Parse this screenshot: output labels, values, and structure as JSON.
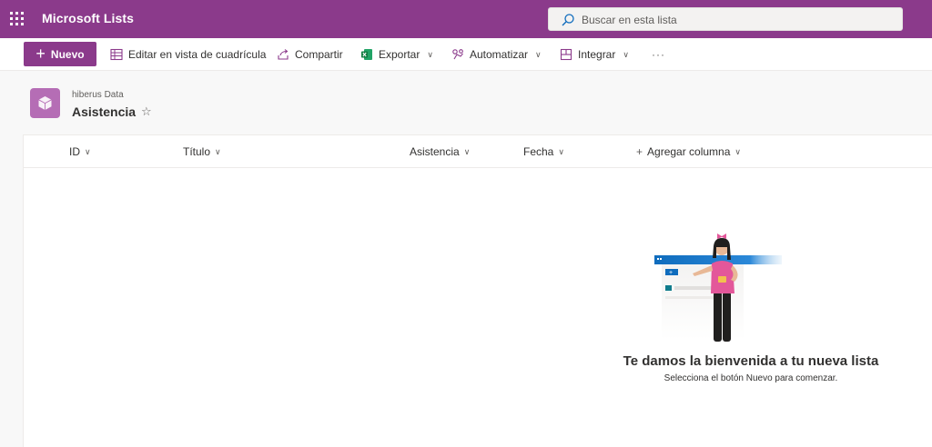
{
  "suite": {
    "app_title": "Microsoft Lists",
    "search_placeholder": "Buscar en esta lista"
  },
  "command_bar": {
    "new_label": "Nuevo",
    "grid_edit_label": "Editar en vista de cuadrícula",
    "share_label": "Compartir",
    "export_label": "Exportar",
    "automate_label": "Automatizar",
    "integrate_label": "Integrar",
    "more_label": "···"
  },
  "page_header": {
    "site_name": "hiberus Data",
    "list_title": "Asistencia",
    "star": "☆"
  },
  "columns": [
    {
      "label": "ID"
    },
    {
      "label": "Título"
    },
    {
      "label": "Asistencia"
    },
    {
      "label": "Fecha"
    },
    {
      "label": "Agregar columna"
    }
  ],
  "empty_state": {
    "title": "Te damos la bienvenida a tu nueva lista",
    "subtitle": "Selecciona el botón Nuevo para comenzar."
  },
  "colors": {
    "brand": "#8b3a8b",
    "site_icon": "#b56db5"
  }
}
